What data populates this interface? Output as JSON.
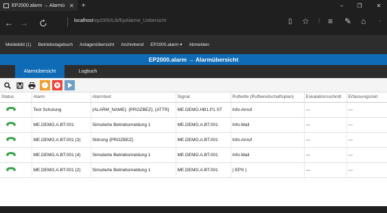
{
  "browser": {
    "tab_title": "EP2000.alarm → Alarmü",
    "tab_close": "✕",
    "new_tab": "+",
    "url_host": "localhost",
    "url_path": "/ep2000/Lib/EpAlarme_Uebersicht",
    "icons": [
      "tab-icon",
      "back-icon",
      "forward-icon",
      "refresh-icon",
      "reading-view-icon",
      "favorite-star-icon",
      "hub-icon",
      "notes-icon",
      "share-icon"
    ],
    "window_controls": [
      "–",
      "❐",
      "✕"
    ]
  },
  "menu": {
    "items": [
      "Meldebild (1)",
      "Betriebstagebuch",
      "Anlagenübersicht",
      "Archivtrend",
      "EP2000.alarm ▾",
      "Abmelden"
    ]
  },
  "page_title": "EP2000.alarm → Alarmübersicht",
  "tabs": [
    "Alarmübersicht",
    "Logbuch"
  ],
  "active_tab": "Alarmübersicht",
  "toolbar": {
    "buttons": [
      "search-icon",
      "save-icon",
      "print-icon",
      "acknowledge-icon",
      "stop-icon",
      "play-icon"
    ],
    "colors": {
      "orange": "#f0a030",
      "red": "#e8453c",
      "blue": "#6f9ec7"
    }
  },
  "table": {
    "columns": [
      "Status",
      "Alarm",
      "Alarmtext",
      "Signal",
      "Rufkette (Rufbereitschaftsplan)",
      "Eskalationsschnitt",
      "Erfassungszeit"
    ],
    "rows": [
      {
        "alarm": "Test Schulung",
        "text": "{ALARM_NAME}: {PROZBEZ}, {ATTR}",
        "signal": "ME.DEMO.HB1.P1.ST",
        "chain": "Info-Anruf",
        "esc": "---",
        "time": "---"
      },
      {
        "alarm": "ME.DEMO.A.BT.001",
        "text": "Simulierte Betriebsmeldung 1",
        "signal": "ME.DEMO.A.BT.001",
        "chain": "Info-Mail",
        "esc": "---",
        "time": "---"
      },
      {
        "alarm": "ME.DEMO.A.BT.001 (3)",
        "text": "Störung {PROZBEZ}",
        "signal": "ME.DEMO.A.BT.001",
        "chain": "Info-Anruf",
        "esc": "---",
        "time": "---"
      },
      {
        "alarm": "ME.DEMO.A.BT.001 (4)",
        "text": "Simulierte Betriebsmeldung 1",
        "signal": "ME.DEMO.A.BT.001",
        "chain": "Info-Mail",
        "esc": "---",
        "time": "---"
      },
      {
        "alarm": "ME.DEMO.A.BT.001 (2)",
        "text": "Simulierte Betriebsmeldung 1",
        "signal": "ME.DEMO.A.BT.001",
        "chain": "( EPS )",
        "esc": "---",
        "time": "---"
      }
    ],
    "status_icon": "phone-handset-icon",
    "status_color": "#3aa04a"
  }
}
